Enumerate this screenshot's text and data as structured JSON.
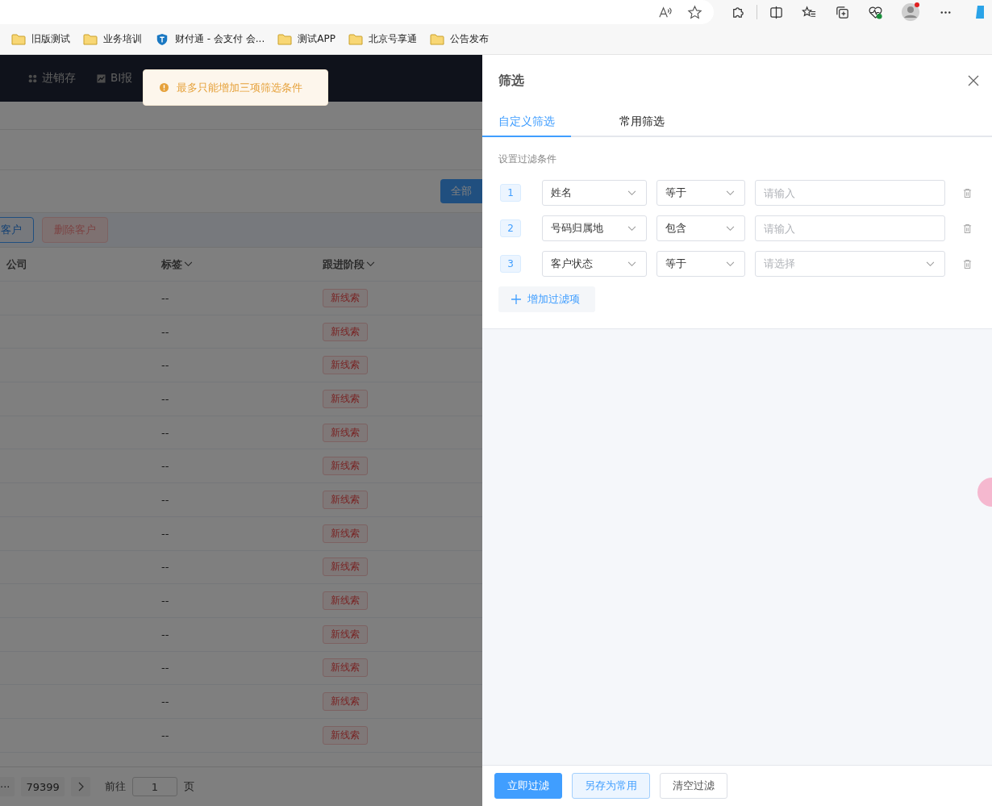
{
  "browser": {
    "bookmarks": [
      {
        "label": "旧版测试",
        "kind": "folder"
      },
      {
        "label": "业务培训",
        "kind": "folder"
      },
      {
        "label": "财付通 - 会支付 会...",
        "kind": "site"
      },
      {
        "label": "测试APP",
        "kind": "folder"
      },
      {
        "label": "北京号享通",
        "kind": "folder"
      },
      {
        "label": "公告发布",
        "kind": "folder"
      }
    ]
  },
  "page": {
    "nav": [
      {
        "label": "进销存",
        "kind": "grid"
      },
      {
        "label": "BI报",
        "kind": "chart"
      }
    ],
    "toast": {
      "kind": "warning",
      "text": "最多只能增加三项筛选条件"
    },
    "all_button": "全部",
    "actions": [
      {
        "label": "客户",
        "kind": "primary"
      },
      {
        "label": "删除客户",
        "kind": "danger"
      }
    ],
    "columns": [
      {
        "label": "公司",
        "dropdown": false
      },
      {
        "label": "标签",
        "dropdown": true
      },
      {
        "label": "跟进阶段",
        "dropdown": true
      }
    ],
    "rows": [
      {
        "tags": "--",
        "stage": "新线索"
      },
      {
        "tags": "--",
        "stage": "新线索"
      },
      {
        "tags": "--",
        "stage": "新线索"
      },
      {
        "tags": "--",
        "stage": "新线索"
      },
      {
        "tags": "--",
        "stage": "新线索"
      },
      {
        "tags": "--",
        "stage": "新线索"
      },
      {
        "tags": "--",
        "stage": "新线索"
      },
      {
        "tags": "--",
        "stage": "新线索"
      },
      {
        "tags": "--",
        "stage": "新线索"
      },
      {
        "tags": "--",
        "stage": "新线索"
      },
      {
        "tags": "--",
        "stage": "新线索"
      },
      {
        "tags": "--",
        "stage": "新线索"
      },
      {
        "tags": "--",
        "stage": "新线索"
      },
      {
        "tags": "--",
        "stage": "新线索"
      }
    ],
    "pagination": {
      "more": "···",
      "last_page": "79399",
      "goto_label": "前往",
      "page_input": "1",
      "page_suffix": "页"
    }
  },
  "drawer": {
    "title": "筛选",
    "tabs": [
      {
        "label": "自定义筛选",
        "selected": true
      },
      {
        "label": "常用筛选",
        "selected": false
      }
    ],
    "section_label": "设置过滤条件",
    "filters": [
      {
        "index": "1",
        "field": "姓名",
        "operator": "等于",
        "kind": "input",
        "placeholder": "请输入"
      },
      {
        "index": "2",
        "field": "号码归属地",
        "operator": "包含",
        "kind": "input",
        "placeholder": "请输入"
      },
      {
        "index": "3",
        "field": "客户状态",
        "operator": "等于",
        "kind": "select",
        "placeholder": "请选择"
      }
    ],
    "add_button": "增加过滤项",
    "buttons": [
      {
        "label": "立即过滤",
        "kind": "primary"
      },
      {
        "label": "另存为常用",
        "kind": "plain"
      },
      {
        "label": "清空过滤",
        "kind": "default"
      }
    ]
  }
}
